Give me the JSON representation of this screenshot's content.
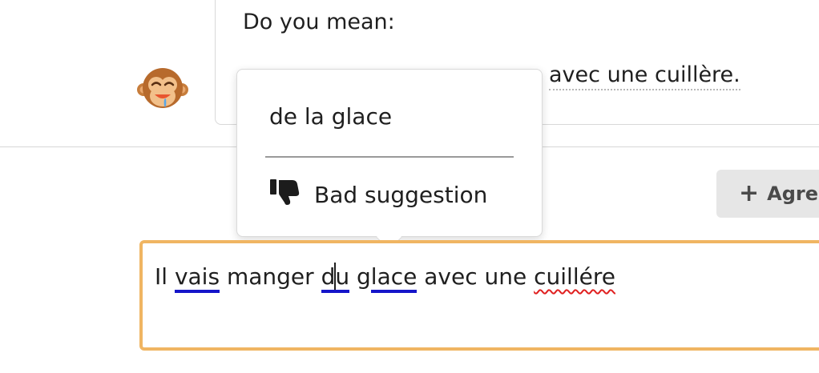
{
  "suggestion_card": {
    "heading": "Do you mean:",
    "sentence_visible_end": "avec une cuillère."
  },
  "avatar": {
    "emoji": "🐵",
    "name": "monkey-avatar"
  },
  "popover": {
    "suggestion": "de la glace",
    "bad_suggestion_label": "Bad suggestion",
    "bad_suggestion_icon": "thumbs-down-icon"
  },
  "agree_button": {
    "label": "Agre",
    "icon": "plus-icon"
  },
  "input": {
    "w1": "Il",
    "w2": "vais",
    "w3": "manger",
    "w4a": "d",
    "w4b": "u",
    "w5a": "g",
    "w5b": "lace",
    "w6": "avec une",
    "w7": "cuillére"
  },
  "colors": {
    "input_border": "#f0b562",
    "grammar_underline": "#1515c9",
    "spelling_underline": "#e02020"
  }
}
